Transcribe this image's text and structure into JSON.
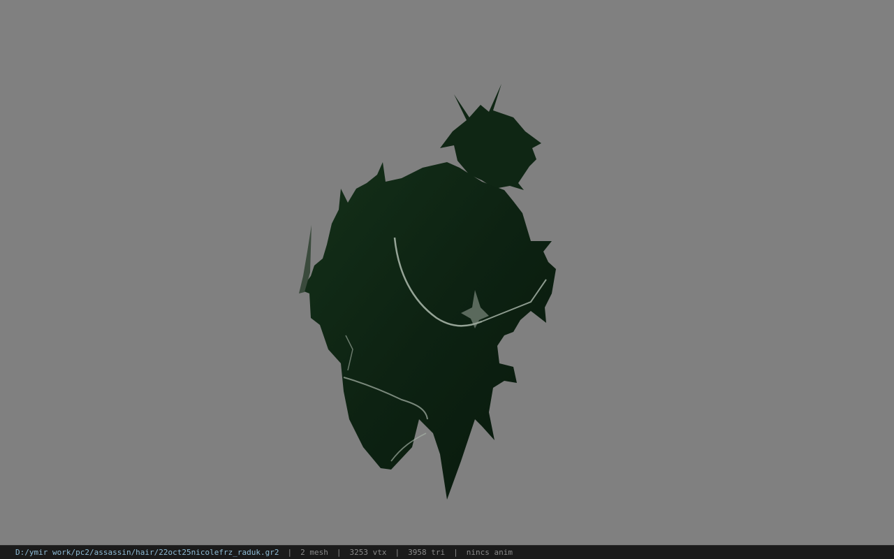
{
  "window": {
    "background_color": "#808080",
    "model_color": "#0e2313"
  },
  "statusbar": {
    "file_path": "D:/ymir work/pc2/assassin/hair/22oct25nicolefrz_raduk.gr2",
    "separator": "|",
    "mesh_count": "2 mesh",
    "vertex_count": "3253 vtx",
    "triangle_count": "3958 tri",
    "animation": "nincs anim"
  }
}
